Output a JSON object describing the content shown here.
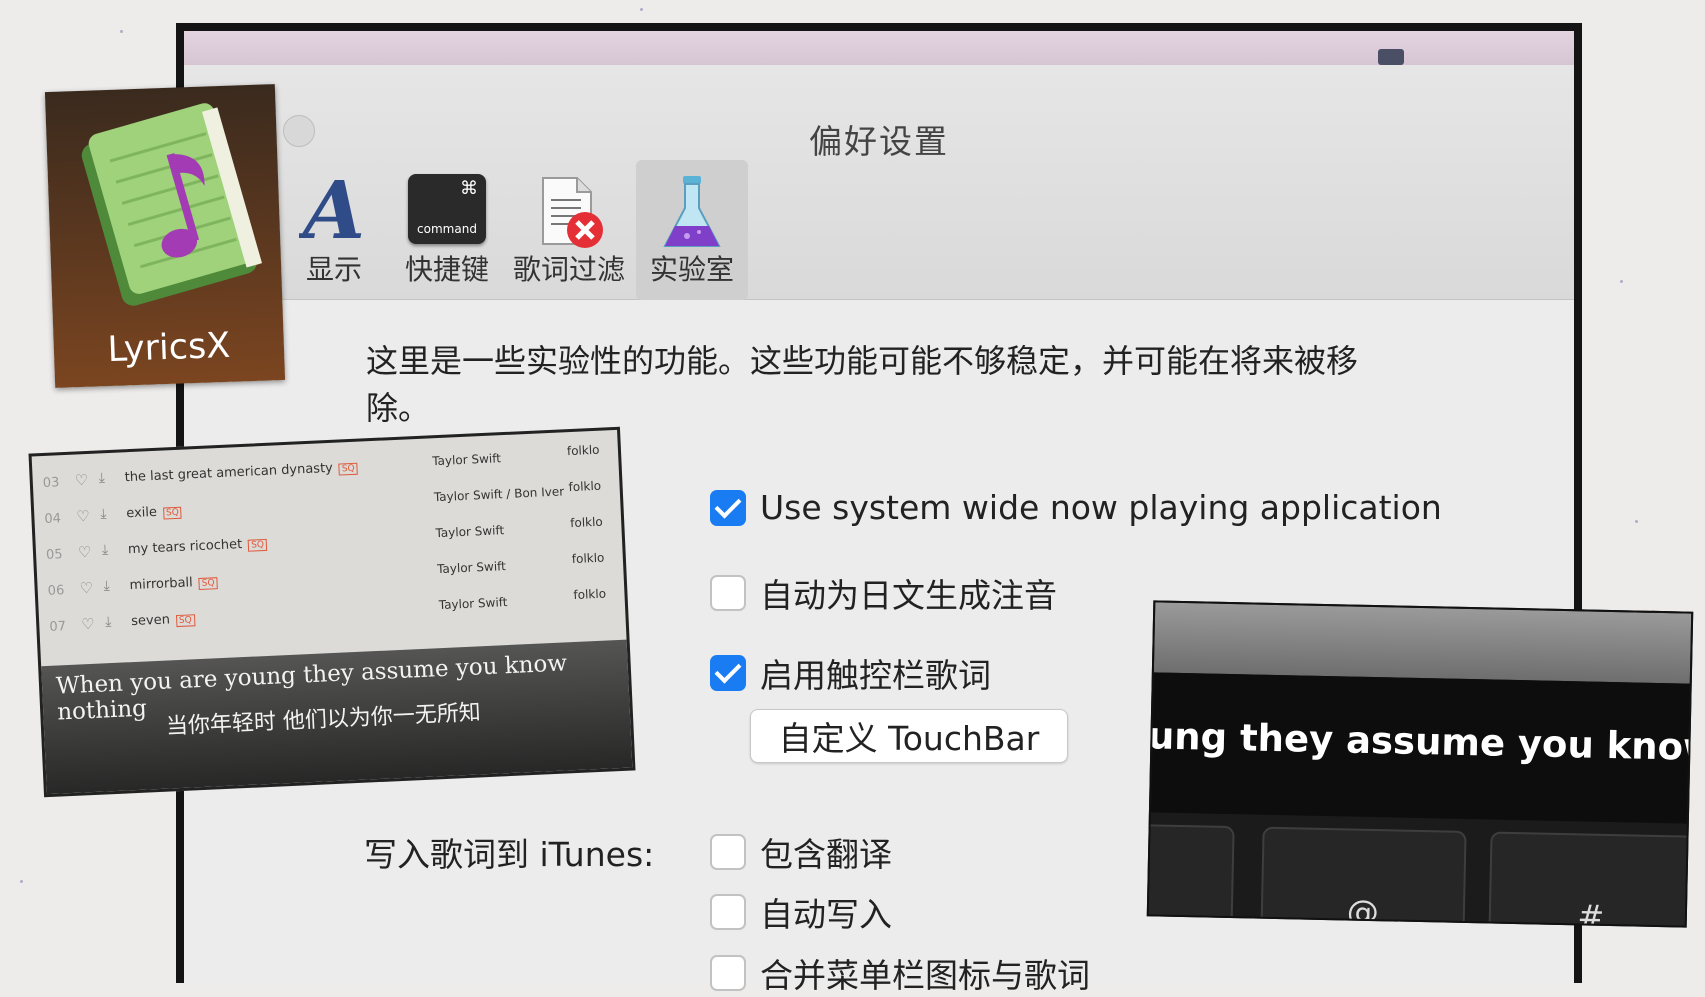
{
  "window": {
    "title": "偏好设置",
    "tabs": [
      {
        "label": "显示",
        "icon": "font-a-icon"
      },
      {
        "label": "快捷键",
        "icon": "command-key-icon",
        "key_text": "command",
        "key_symbol": "⌘"
      },
      {
        "label": "歌词过滤",
        "icon": "document-reject-icon"
      },
      {
        "label": "实验室",
        "icon": "flask-icon",
        "active": true
      }
    ],
    "description": "这里是一些实验性的功能。这些功能可能不够稳定，并可能在将来被移除。",
    "options": {
      "system_now_playing": {
        "label": "Use system wide now playing application",
        "checked": true
      },
      "furigana": {
        "label": "自动为日文生成注音",
        "checked": false
      },
      "touchbar_lyrics": {
        "label": "启用触控栏歌词",
        "checked": true
      },
      "customize_touchbar": "自定义 TouchBar",
      "itunes_label": "写入歌词到 iTunes:",
      "include_translation": {
        "label": "包含翻译",
        "checked": false
      },
      "auto_write": {
        "label": "自动写入",
        "checked": false
      },
      "merge_menubar": {
        "label": "合并菜单栏图标与歌词",
        "checked": false
      }
    },
    "accent_color": "#1a7cf2"
  },
  "app_icon": {
    "name": "LyricsX"
  },
  "playlist": {
    "rows": [
      {
        "num": "03",
        "song": "the last great american dynasty",
        "badge": "SQ",
        "artist": "Taylor Swift",
        "album": "folklo"
      },
      {
        "num": "04",
        "song": "exile",
        "badge": "SQ",
        "artist": "Taylor Swift / Bon Iver",
        "album": "folklo"
      },
      {
        "num": "05",
        "song": "my tears ricochet",
        "badge": "SQ",
        "artist": "Taylor Swift",
        "album": "folklo"
      },
      {
        "num": "06",
        "song": "mirrorball",
        "badge": "SQ",
        "artist": "Taylor Swift",
        "album": "folklo"
      },
      {
        "num": "07",
        "song": "seven",
        "badge": "SQ",
        "artist": "Taylor Swift",
        "album": "folklo"
      }
    ],
    "lyric_en": "When you are young they assume you know nothing",
    "lyric_zh": "当你年轻时 他们以为你一无所知"
  },
  "touchbar_photo": {
    "lyric": "oung they assume you know no",
    "keys": [
      "@",
      "#"
    ]
  }
}
